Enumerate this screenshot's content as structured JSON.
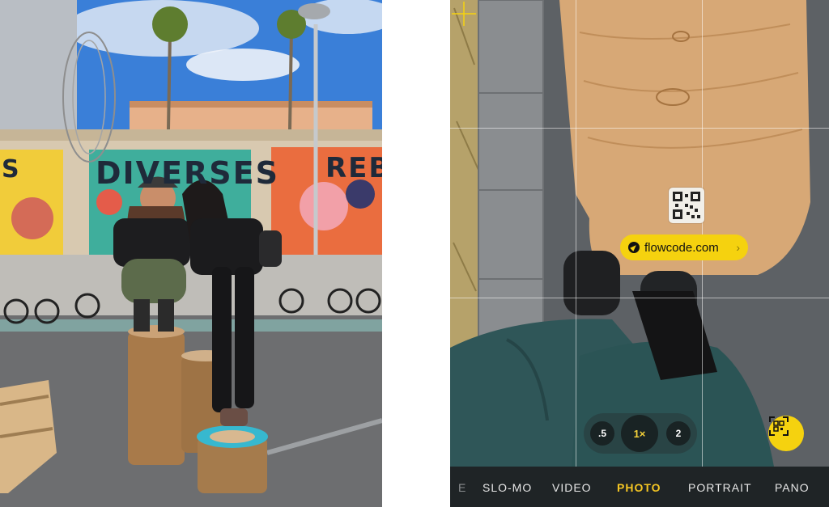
{
  "left_photo": {
    "wall_text_left": "DIVERSES",
    "wall_text_right": "REBEL",
    "wall_text_edge": "S"
  },
  "camera": {
    "detected_url": "flowcode.com",
    "url_chevron": "›",
    "zoom_options": [
      ".5",
      "1×",
      "2"
    ],
    "zoom_selected": "1×",
    "modes": [
      "E",
      "SLO-MO",
      "VIDEO",
      "PHOTO",
      "PORTRAIT",
      "PANO"
    ],
    "active_mode": "PHOTO",
    "accent_color": "#f5d20f",
    "icons": {
      "url_icon": "compass-icon",
      "scan_icon": "qr-scan-icon"
    }
  }
}
